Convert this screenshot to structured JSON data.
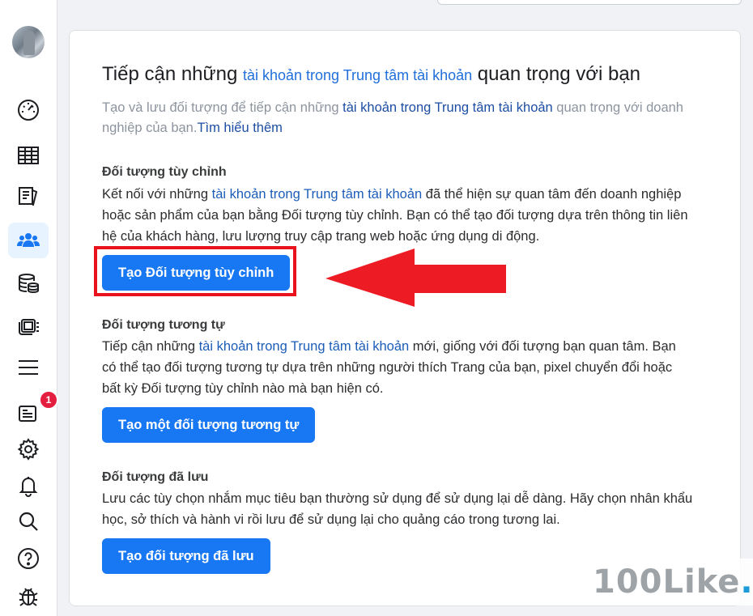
{
  "sidebar": {
    "items": [
      {
        "name": "gauge-icon"
      },
      {
        "name": "table-icon"
      },
      {
        "name": "pages-icon"
      },
      {
        "name": "audience-icon",
        "active": true
      },
      {
        "name": "database-icon"
      },
      {
        "name": "catalog-icon"
      },
      {
        "name": "menu-icon"
      },
      {
        "name": "notes-icon",
        "badge": "1"
      },
      {
        "name": "gear-icon"
      },
      {
        "name": "bell-icon"
      },
      {
        "name": "search-icon"
      },
      {
        "name": "help-icon"
      },
      {
        "name": "bug-icon"
      }
    ]
  },
  "main": {
    "title_prefix": "Tiếp cận những ",
    "title_link": "tài khoản trong Trung tâm tài khoản",
    "title_suffix": " quan trọng với bạn",
    "subtitle_prefix": "Tạo và lưu đối tượng để tiếp cận những ",
    "subtitle_link": "tài khoản trong Trung tâm tài khoản",
    "subtitle_suffix": " quan trọng với doanh nghiệp của bạn.",
    "learn_more": "Tìm hiểu thêm",
    "sections": [
      {
        "heading": "Đối tượng tùy chỉnh",
        "body_prefix": "Kết nối với những ",
        "body_link": "tài khoản trong Trung tâm tài khoản",
        "body_suffix": " đã thể hiện sự quan tâm đến doanh nghiệp hoặc sản phẩm của bạn bằng Đối tượng tùy chỉnh. Bạn có thể tạo đối tượng dựa trên thông tin liên hệ của khách hàng, lưu lượng truy cập trang web hoặc ứng dụng di động.",
        "button": "Tạo Đối tượng tùy chỉnh"
      },
      {
        "heading": "Đối tượng tương tự",
        "body_prefix": "Tiếp cận những ",
        "body_link": "tài khoản trong Trung tâm tài khoản",
        "body_suffix": " mới, giống với đối tượng bạn quan tâm. Bạn có thể tạo đối tượng tương tự dựa trên những người thích Trang của bạn, pixel chuyển đổi hoặc bất kỳ Đối tượng tùy chỉnh nào mà bạn hiện có.",
        "button": "Tạo một đối tượng tương tự"
      },
      {
        "heading": "Đối tượng đã lưu",
        "body": "Lưu các tùy chọn nhắm mục tiêu bạn thường sử dụng để sử dụng lại dễ dàng. Hãy chọn nhân khẩu học, sở thích và hành vi rồi lưu để sử dụng lại cho quảng cáo trong tương lai.",
        "button": "Tạo đối tượng đã lưu"
      }
    ]
  },
  "watermark": {
    "text": "100Like",
    "dot": "."
  },
  "colors": {
    "accent": "#1877f2",
    "highlight": "#e8131c",
    "link": "#1d5db8"
  }
}
